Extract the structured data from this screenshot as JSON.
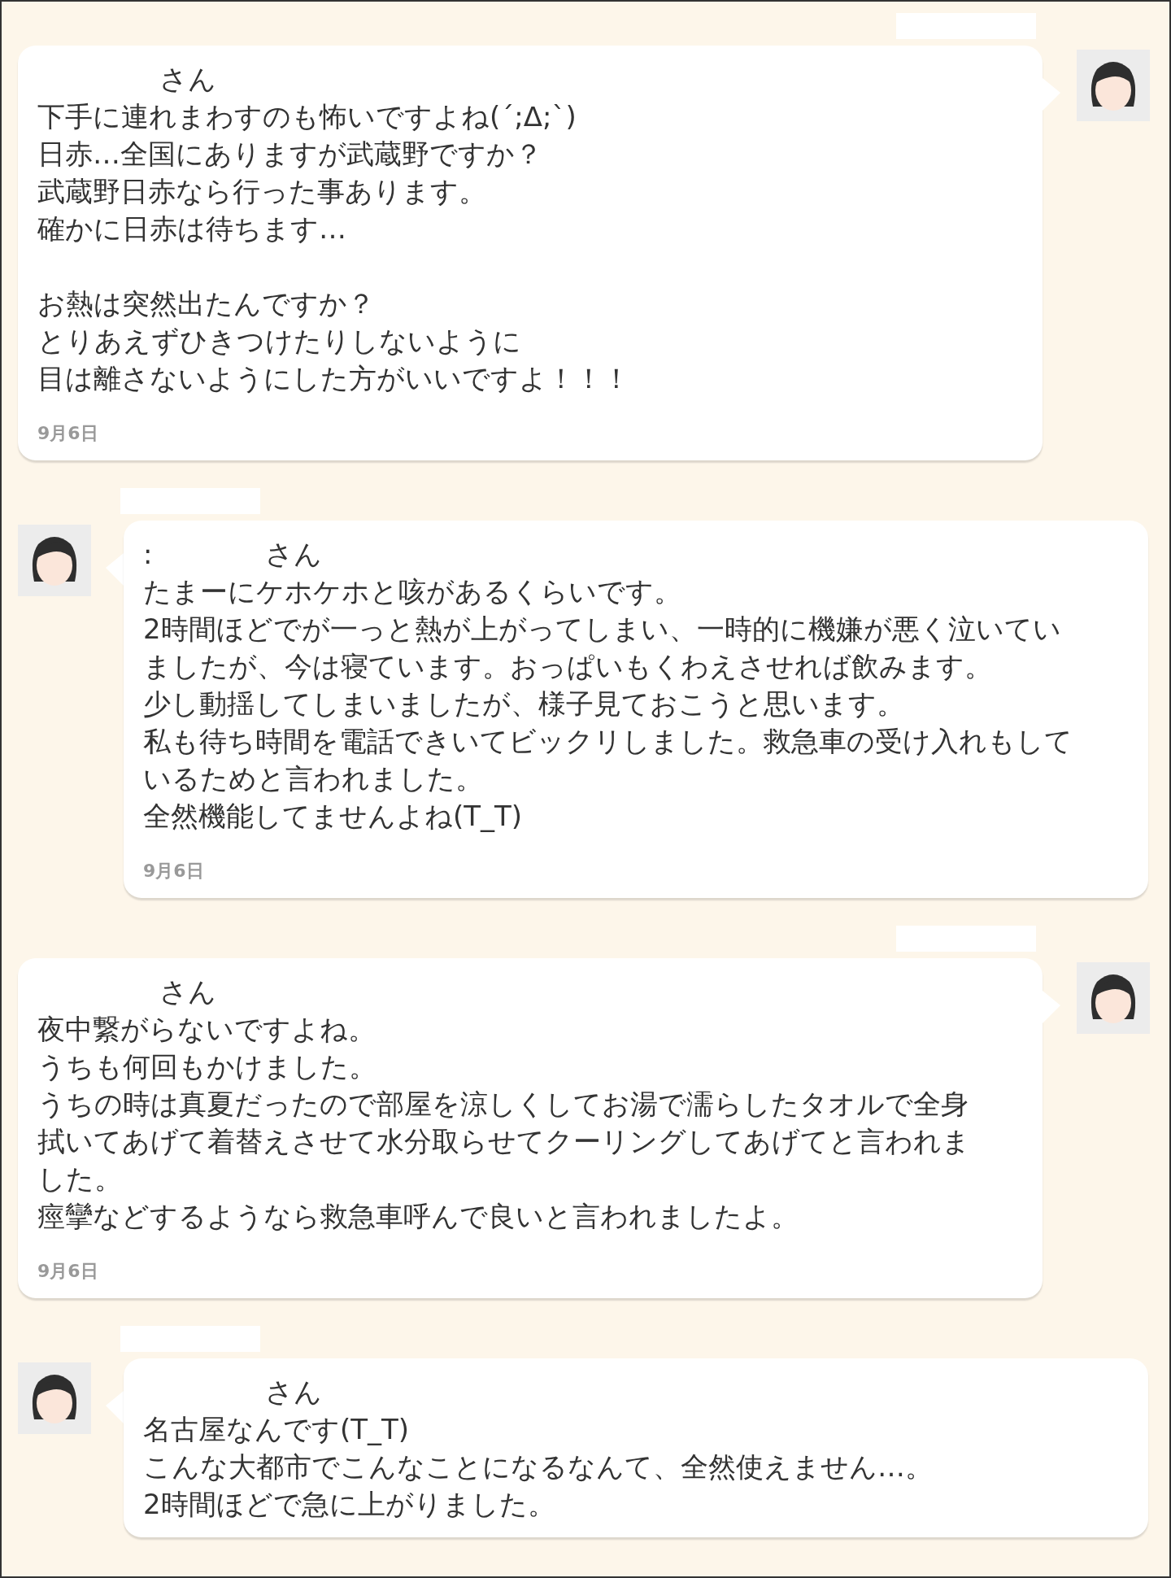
{
  "messages": [
    {
      "kind": "outgoing",
      "salutation": "さん",
      "paragraphs": [
        [
          "下手に連れまわすのも怖いですよね(´;ᐃ;`)",
          "日赤…全国にありますが武蔵野ですか？",
          "武蔵野日赤なら行った事あります。",
          "確かに日赤は待ちます…"
        ],
        [
          "お熱は突然出たんですか？",
          "とりあえずひきつけたりしないように",
          "目は離さないようにした方がいいですよ！！！"
        ]
      ],
      "date": "9月6日"
    },
    {
      "kind": "incoming",
      "salutation_prefix": ":",
      "salutation": "さん",
      "paragraphs": [
        [
          "たまーにケホケホと咳があるくらいです。",
          "2時間ほどでが一っと熱が上がってしまい、一時的に機嫌が悪く泣いてい",
          "ましたが、今は寝ています。おっぱいもくわえさせれば飲みます。",
          "少し動揺してしまいましたが、様子見ておこうと思います。",
          "私も待ち時間を電話できいてビックリしました。救急車の受け入れもして",
          "いるためと言われました。",
          "全然機能してませんよね(T_T)"
        ]
      ],
      "date": "9月6日"
    },
    {
      "kind": "outgoing",
      "salutation": "さん",
      "paragraphs": [
        [
          "夜中繋がらないですよね。",
          "うちも何回もかけました。",
          "うちの時は真夏だったので部屋を涼しくしてお湯で濡らしたタオルで全身",
          "拭いてあげて着替えさせて水分取らせてクーリングしてあげてと言われま",
          "した。",
          "痙攣などするようなら救急車呼んで良いと言われましたよ。"
        ]
      ],
      "date": "9月6日"
    },
    {
      "kind": "incoming",
      "salutation": "さん",
      "paragraphs": [
        [
          "名古屋なんです(T_T)",
          "こんな大都市でこんなことになるなんて、全然使えません…。",
          "2時間ほどで急に上がりました。"
        ]
      ]
    }
  ]
}
